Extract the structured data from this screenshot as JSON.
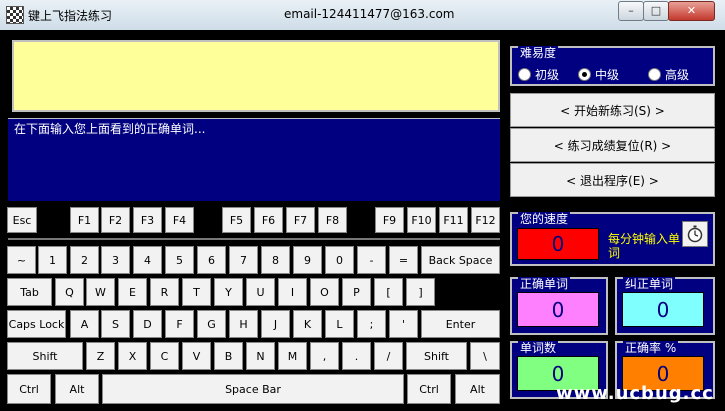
{
  "window": {
    "title": "键上飞指法练习",
    "email": "email-124411477@163.com",
    "min_label": "–",
    "max_label": "□",
    "close_label": "✕"
  },
  "practice": {
    "input_label": "在下面输入您上面看到的正确单词..."
  },
  "difficulty": {
    "label": "难易度",
    "options": [
      "初级",
      "中级",
      "高级"
    ],
    "selected": "中级"
  },
  "actions": {
    "start": "< 开始新练习(S) >",
    "reset": "< 练习成绩复位(R) >",
    "exit": "< 退出程序(E) >"
  },
  "speed": {
    "label": "您的速度",
    "value": "0",
    "unit": "每分钟输入单词"
  },
  "stats": {
    "correct": {
      "label": "正确单词",
      "value": "0"
    },
    "corrected": {
      "label": "纠正单词",
      "value": "0"
    },
    "words": {
      "label": "单词数",
      "value": "0"
    },
    "accuracy": {
      "label": "正确率 %",
      "value": "0"
    }
  },
  "keyboard": {
    "fn_row": [
      "Esc",
      "F1",
      "F2",
      "F3",
      "F4",
      "F5",
      "F6",
      "F7",
      "F8",
      "F9",
      "F10",
      "F11",
      "F12"
    ],
    "row1": [
      "~",
      "1",
      "2",
      "3",
      "4",
      "5",
      "6",
      "7",
      "8",
      "9",
      "0",
      "-",
      "=",
      "Back Space"
    ],
    "row2": [
      "Tab",
      "Q",
      "W",
      "E",
      "R",
      "T",
      "Y",
      "U",
      "I",
      "O",
      "P",
      "[",
      "]"
    ],
    "row3": [
      "Caps Lock",
      "A",
      "S",
      "D",
      "F",
      "G",
      "H",
      "J",
      "K",
      "L",
      ";",
      "'",
      "Enter"
    ],
    "row4": [
      "Shift",
      "Z",
      "X",
      "C",
      "V",
      "B",
      "N",
      "M",
      ",",
      ".",
      "/",
      "Shift",
      "\\"
    ],
    "row5": [
      "Ctrl",
      "Alt",
      "Space Bar",
      "Ctrl",
      "Alt"
    ]
  },
  "watermark": "www.ucbug.cc",
  "colors": {
    "display": "#ffff99",
    "panel": "#000080",
    "speed_box": "#ff0000",
    "correct_box": "#ff80ff",
    "corrected_box": "#80ffff",
    "words_box": "#80ff80",
    "accuracy_box": "#ff8000"
  }
}
